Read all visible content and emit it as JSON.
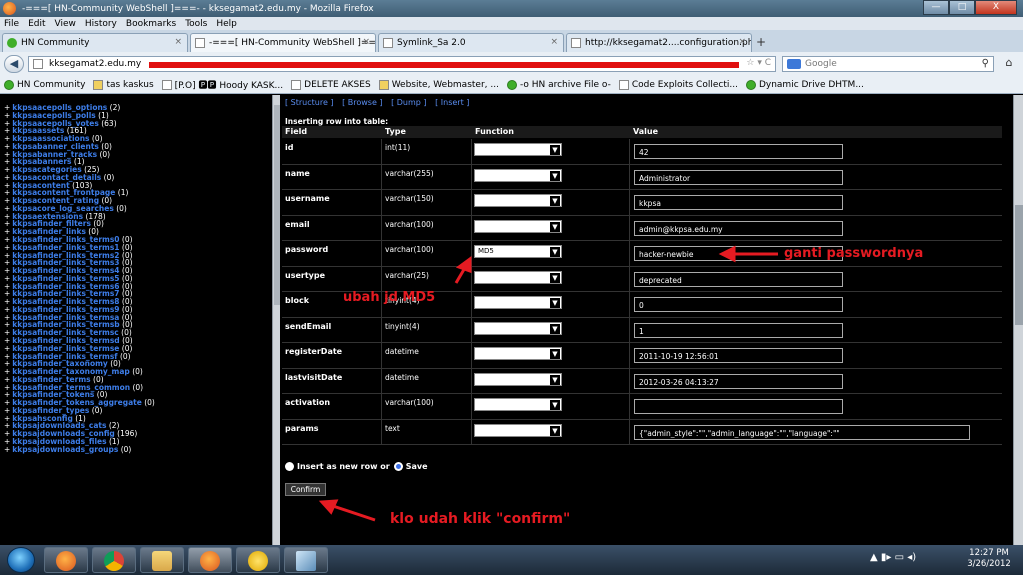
{
  "window": {
    "title": "-===[ HN-Community WebShell ]===- - kksegamat2.edu.my - Mozilla Firefox",
    "btn_min": "—",
    "btn_max": "□",
    "btn_close": "X"
  },
  "menu": [
    "File",
    "Edit",
    "View",
    "History",
    "Bookmarks",
    "Tools",
    "Help"
  ],
  "tabs": [
    {
      "label": "HN Community",
      "close": "×"
    },
    {
      "label": "-===[ HN-Community WebShell ]==...",
      "close": "×"
    },
    {
      "label": "Symlink_Sa 2.0",
      "close": "×"
    },
    {
      "label": "http://kksegamat2....configuration.php",
      "close": "×"
    }
  ],
  "new_tab": "+",
  "nav": {
    "back": "◀",
    "url": "kksegamat2.edu.my",
    "url_icons": "☆ ▾ C",
    "search_placeholder": "Google",
    "search_go": "⚲",
    "home": "⌂"
  },
  "bookmarks": [
    "HN Community",
    "tas kaskus",
    "[P.O] 🅿🅿 Hoody KASK...",
    "DELETE AKSES",
    "Website, Webmaster, ...",
    "-o HN archive File o-",
    "Code Exploits Collecti...",
    "Dynamic Drive DHTM..."
  ],
  "tables": [
    {
      "name": "kkpsaacepolls_options",
      "count": "(2)"
    },
    {
      "name": "kkpsaacepolls_polls",
      "count": "(1)"
    },
    {
      "name": "kkpsaacepolls_votes",
      "count": "(63)"
    },
    {
      "name": "kkpsaassets",
      "count": "(161)"
    },
    {
      "name": "kkpsaassociations",
      "count": "(0)"
    },
    {
      "name": "kkpsabanner_clients",
      "count": "(0)"
    },
    {
      "name": "kkpsabanner_tracks",
      "count": "(0)"
    },
    {
      "name": "kkpsabanners",
      "count": "(1)"
    },
    {
      "name": "kkpsacategories",
      "count": "(25)"
    },
    {
      "name": "kkpsacontact_details",
      "count": "(0)"
    },
    {
      "name": "kkpsacontent",
      "count": "(103)"
    },
    {
      "name": "kkpsacontent_frontpage",
      "count": "(1)"
    },
    {
      "name": "kkpsacontent_rating",
      "count": "(0)"
    },
    {
      "name": "kkpsacore_log_searches",
      "count": "(0)"
    },
    {
      "name": "kkpsaextensions",
      "count": "(178)"
    },
    {
      "name": "kkpsafinder_filters",
      "count": "(0)"
    },
    {
      "name": "kkpsafinder_links",
      "count": "(0)"
    },
    {
      "name": "kkpsafinder_links_terms0",
      "count": "(0)"
    },
    {
      "name": "kkpsafinder_links_terms1",
      "count": "(0)"
    },
    {
      "name": "kkpsafinder_links_terms2",
      "count": "(0)"
    },
    {
      "name": "kkpsafinder_links_terms3",
      "count": "(0)"
    },
    {
      "name": "kkpsafinder_links_terms4",
      "count": "(0)"
    },
    {
      "name": "kkpsafinder_links_terms5",
      "count": "(0)"
    },
    {
      "name": "kkpsafinder_links_terms6",
      "count": "(0)"
    },
    {
      "name": "kkpsafinder_links_terms7",
      "count": "(0)"
    },
    {
      "name": "kkpsafinder_links_terms8",
      "count": "(0)"
    },
    {
      "name": "kkpsafinder_links_terms9",
      "count": "(0)"
    },
    {
      "name": "kkpsafinder_links_termsa",
      "count": "(0)"
    },
    {
      "name": "kkpsafinder_links_termsb",
      "count": "(0)"
    },
    {
      "name": "kkpsafinder_links_termsc",
      "count": "(0)"
    },
    {
      "name": "kkpsafinder_links_termsd",
      "count": "(0)"
    },
    {
      "name": "kkpsafinder_links_termse",
      "count": "(0)"
    },
    {
      "name": "kkpsafinder_links_termsf",
      "count": "(0)"
    },
    {
      "name": "kkpsafinder_taxonomy",
      "count": "(0)"
    },
    {
      "name": "kkpsafinder_taxonomy_map",
      "count": "(0)"
    },
    {
      "name": "kkpsafinder_terms",
      "count": "(0)"
    },
    {
      "name": "kkpsafinder_terms_common",
      "count": "(0)"
    },
    {
      "name": "kkpsafinder_tokens",
      "count": "(0)"
    },
    {
      "name": "kkpsafinder_tokens_aggregate",
      "count": "(0)"
    },
    {
      "name": "kkpsafinder_types",
      "count": "(0)"
    },
    {
      "name": "kkpsahsconfig",
      "count": "(1)"
    },
    {
      "name": "kkpsajdownloads_cats",
      "count": "(2)"
    },
    {
      "name": "kkpsajdownloads_config",
      "count": "(196)"
    },
    {
      "name": "kkpsajdownloads_files",
      "count": "(1)"
    },
    {
      "name": "kkpsajdownloads_groups",
      "count": "(0)"
    }
  ],
  "main": {
    "links": [
      "[ Structure ]",
      "[ Browse ]",
      "[ Dump ]",
      "[ Insert ]"
    ],
    "caption": "Inserting row into table:",
    "headers": {
      "field": "Field",
      "type": "Type",
      "function": "Function",
      "value": "Value"
    },
    "rows": [
      {
        "field": "id",
        "type": "int(11)",
        "function": "",
        "value": "42"
      },
      {
        "field": "name",
        "type": "varchar(255)",
        "function": "",
        "value": "Administrator"
      },
      {
        "field": "username",
        "type": "varchar(150)",
        "function": "",
        "value": "kkpsa"
      },
      {
        "field": "email",
        "type": "varchar(100)",
        "function": "",
        "value": "admin@kkpsa.edu.my"
      },
      {
        "field": "password",
        "type": "varchar(100)",
        "function": "MD5",
        "value": "hacker-newbie"
      },
      {
        "field": "usertype",
        "type": "varchar(25)",
        "function": "",
        "value": "deprecated"
      },
      {
        "field": "block",
        "type": "tinyint(4)",
        "function": "",
        "value": "0"
      },
      {
        "field": "sendEmail",
        "type": "tinyint(4)",
        "function": "",
        "value": "1"
      },
      {
        "field": "registerDate",
        "type": "datetime",
        "function": "",
        "value": "2011-10-19 12:56:01"
      },
      {
        "field": "lastvisitDate",
        "type": "datetime",
        "function": "",
        "value": "2012-03-26 04:13:27"
      },
      {
        "field": "activation",
        "type": "varchar(100)",
        "function": "",
        "value": ""
      },
      {
        "field": "params",
        "type": "text",
        "function": "",
        "value": "{\"admin_style\":\"\",\"admin_language\":\"\",\"language\":\"\",\"ed"
      }
    ],
    "opt_insert": "Insert as new row or",
    "opt_save": "Save",
    "confirm": "Confirm"
  },
  "annotations": {
    "password": "ganti passwordnya",
    "md5": "ubah jd MD5",
    "confirm": "klo udah klik \"confirm\"",
    "color": "#e51b22"
  },
  "taskbar": {
    "time": "12:27 PM",
    "date": "3/26/2012",
    "tray": "▲  ▮▸  ▭  ◂)"
  }
}
